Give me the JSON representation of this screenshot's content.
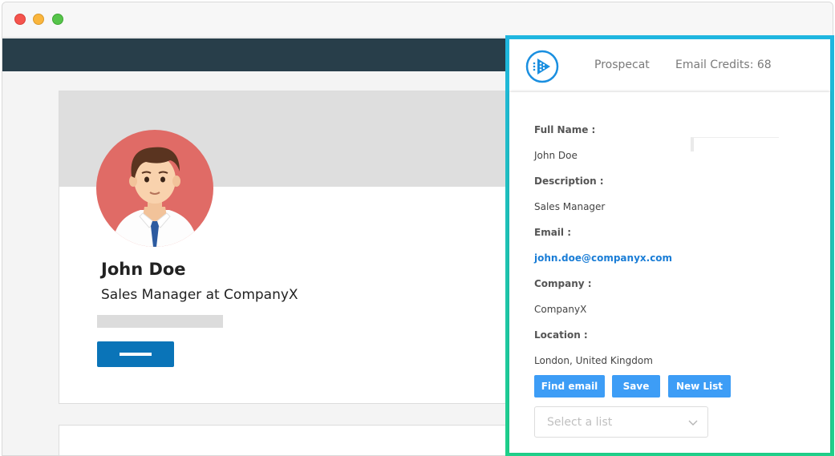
{
  "profile": {
    "name": "John Doe",
    "headline": "Sales Manager at CompanyX"
  },
  "extension": {
    "brand": "Prospecat",
    "credits": "Email Credits: 68",
    "fields": {
      "full_name_label": "Full Name :",
      "full_name_value": "John Doe",
      "description_label": "Description :",
      "description_value": "Sales Manager",
      "email_label": "Email :",
      "email_value": "john.doe@companyx.com",
      "company_label": "Company :",
      "company_value": "CompanyX",
      "location_label": "Location :",
      "location_value": "London, United Kingdom"
    },
    "buttons": {
      "find_email": "Find email",
      "save": "Save",
      "new_list": "New List"
    },
    "select_placeholder": "Select a list"
  },
  "colors": {
    "navbar": "#283e4a",
    "accent_button": "#3d9df6",
    "connect_button": "#0a74b8",
    "border_gradient_start": "#1fb6e0",
    "border_gradient_end": "#1fd08a",
    "email_link": "#1a7dd6"
  },
  "icons": {
    "logo": "prospecat-play-logo-icon",
    "chevron": "chevron-down-icon"
  }
}
